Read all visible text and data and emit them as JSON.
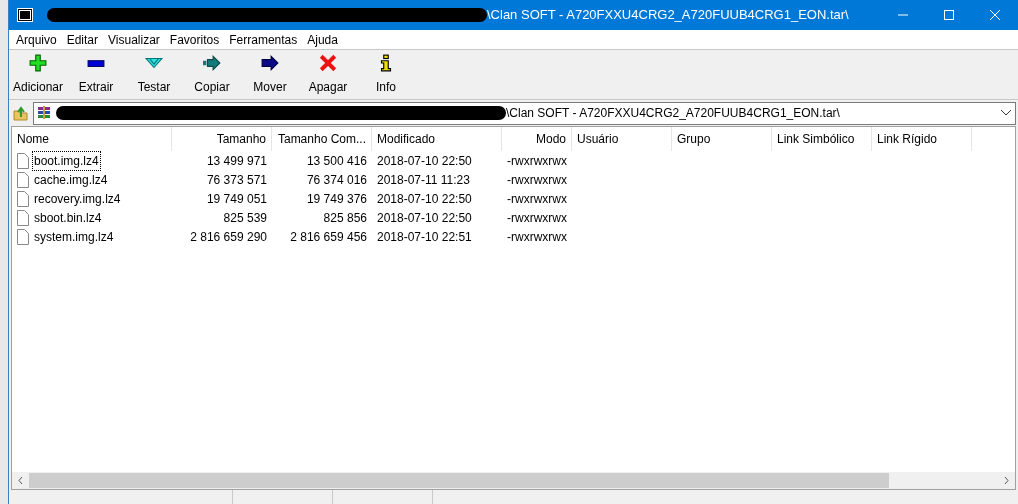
{
  "window": {
    "title": "\\Clan SOFT - A720FXXU4CRG2_A720FUUB4CRG1_EON.tar\\"
  },
  "menu": [
    "Arquivo",
    "Editar",
    "Visualizar",
    "Favoritos",
    "Ferramentas",
    "Ajuda"
  ],
  "toolbar": [
    {
      "kind": "add",
      "label": "Adicionar"
    },
    {
      "kind": "extract",
      "label": "Extrair"
    },
    {
      "kind": "test",
      "label": "Testar"
    },
    {
      "kind": "copy",
      "label": "Copiar"
    },
    {
      "kind": "move",
      "label": "Mover"
    },
    {
      "kind": "delete",
      "label": "Apagar"
    },
    {
      "kind": "info",
      "label": "Info"
    }
  ],
  "address": {
    "value": "\\Clan SOFT - A720FXXU4CRG2_A720FUUB4CRG1_EON.tar\\"
  },
  "table": {
    "columns": [
      "Nome",
      "Tamanho",
      "Tamanho Com...",
      "Modificado",
      "Modo",
      "Usuário",
      "Grupo",
      "Link Simbólico",
      "Link Rígido"
    ],
    "rows": [
      {
        "focused": true,
        "cells": [
          "boot.img.lz4",
          "13 499 971",
          "13 500 416",
          "2018-07-10 22:50",
          "-rwxrwxrwx"
        ]
      },
      {
        "focused": false,
        "cells": [
          "cache.img.lz4",
          "76 373 571",
          "76 374 016",
          "2018-07-11 11:23",
          "-rwxrwxrwx"
        ]
      },
      {
        "focused": false,
        "cells": [
          "recovery.img.lz4",
          "19 749 051",
          "19 749 376",
          "2018-07-10 22:50",
          "-rwxrwxrwx"
        ]
      },
      {
        "focused": false,
        "cells": [
          "sboot.bin.lz4",
          "825 539",
          "825 856",
          "2018-07-10 22:50",
          "-rwxrwxrwx"
        ]
      },
      {
        "focused": false,
        "cells": [
          "system.img.lz4",
          "2 816 659 290",
          "2 816 659 456",
          "2018-07-10 22:51",
          "-rwxrwxrwx"
        ]
      }
    ]
  }
}
